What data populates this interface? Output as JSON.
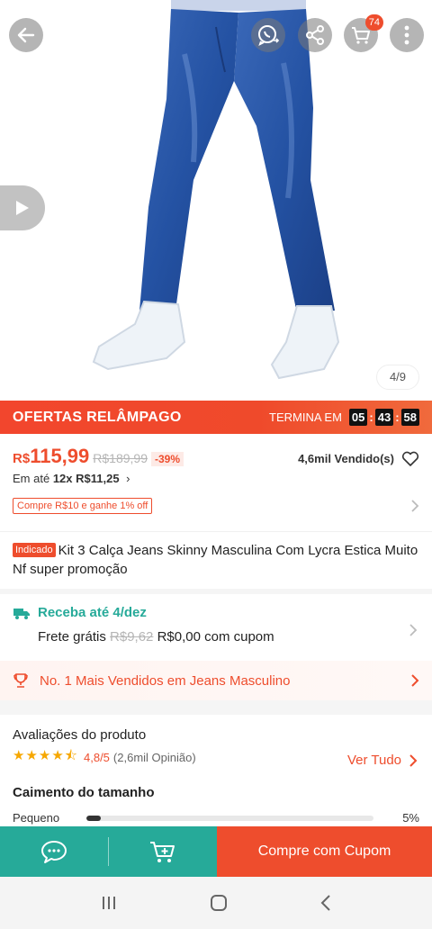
{
  "header": {
    "cart_count": "74",
    "image_pager": "4/9"
  },
  "flash": {
    "title": "OFERTAS RELÂMPAGO",
    "ends_label": "TERMINA EM",
    "hours": "05",
    "minutes": "43",
    "seconds": "58"
  },
  "price": {
    "currency": "R$",
    "value": "115,99",
    "old": "R$189,99",
    "discount": "-39%",
    "sold": "4,6mil Vendido(s)",
    "installments_prefix": "Em até",
    "installments_value": "12x R$11,25",
    "coupon_tag": "Compre R$10 e ganhe 1% off"
  },
  "product": {
    "badge": "Indicado",
    "title": "Kit 3 Calça Jeans Skinny Masculina Com Lycra Estica Muito Nf super promoção"
  },
  "delivery": {
    "eta": "Receba até 4/dez",
    "shipping_label": "Frete grátis",
    "shipping_old": "R$9,62",
    "shipping_new": "R$0,00 com cupom"
  },
  "ranking": {
    "text": "No. 1 Mais Vendidos em Jeans Masculino"
  },
  "reviews": {
    "title": "Avaliações do produto",
    "stars": "★★★★⯪",
    "rating": "4,8/5",
    "count": "(2,6mil Opinião)",
    "see_all": "Ver Tudo",
    "fit_title": "Caimento do tamanho",
    "fit_label": "Pequeno",
    "fit_percent": "5%",
    "fit_fraction": 0.05
  },
  "actions": {
    "buy_label": "Compre com Cupom"
  },
  "colors": {
    "brand": "#ee4d2d",
    "teal": "#26aa99",
    "star": "#f6a700"
  }
}
